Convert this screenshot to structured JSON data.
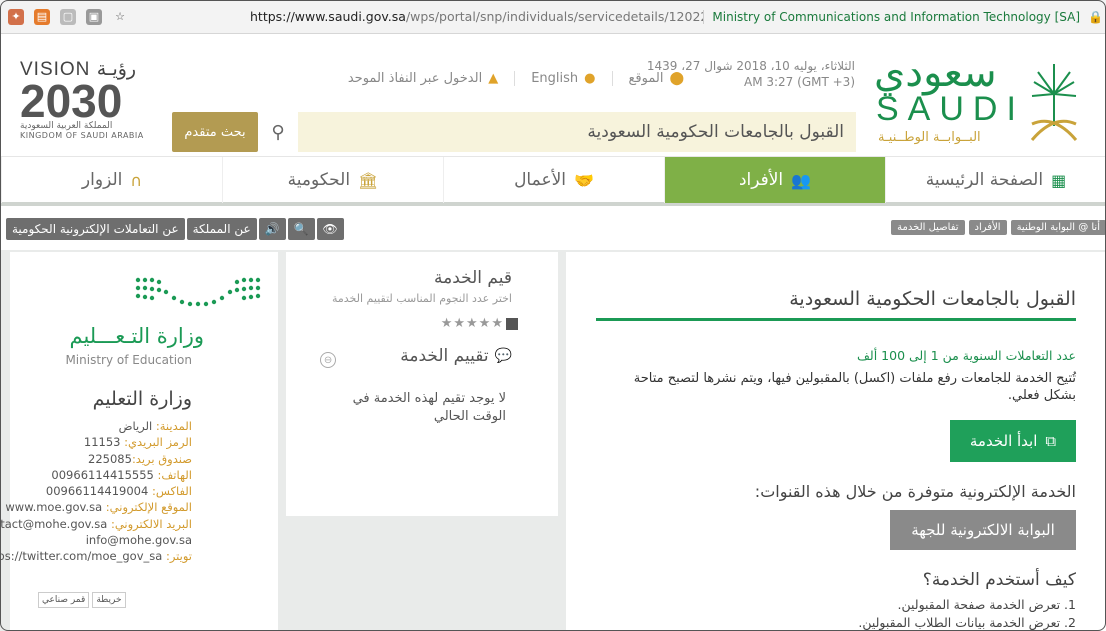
{
  "browser": {
    "url_host": "https://www.saudi.gov.sa",
    "url_path": "/wps/portal/snp/individuals/servicedetails/12022",
    "site_name": "Ministry of Communications and Information Technology [SA]"
  },
  "header": {
    "saudi_ar": "سعودي",
    "saudi_en": "SAUDI",
    "saudi_sub": "البــوابــة الوطــنيـة",
    "vision_top": "VISION رؤيـة",
    "vision_num": "2030",
    "vision_ar": "المملكة العربية السعودية",
    "vision_en": "KINGDOM OF SAUDI ARABIA",
    "link_location": "الموقع",
    "link_english": "English",
    "link_login": "الدخول عبر النفاذ الموحد",
    "date_line1": "الثلاثاء، يوليه 10، 2018 شوال 27، 1439",
    "date_line2": "(GMT +3) AM 3:27",
    "search_value": "القبول بالجامعات الحكومية السعودية",
    "advanced_search": "بحث متقدم"
  },
  "nav": {
    "home": "الصفحة الرئيسية",
    "individuals": "الأفراد",
    "business": "الأعمال",
    "government": "الحكومية",
    "visitors": "الزوار"
  },
  "toolbar": {
    "egov": "عن التعاملات الإلكترونية الحكومية",
    "kingdom": "عن المملكة",
    "crumbs": [
      "أنا @ البوابة الوطنية",
      "الأفراد",
      "تفاصيل الخدمة"
    ]
  },
  "ministry": {
    "moe_ar": "وزارة التـعـــليم",
    "moe_en": "Ministry of Education",
    "title": "وزارة التعليم",
    "info": [
      {
        "k": "المدينة:",
        "v": "الرياض"
      },
      {
        "k": "الرمز البريدي:",
        "v": "11153"
      },
      {
        "k": "صندوق بريد:",
        "v": "225085"
      },
      {
        "k": "الهاتف:",
        "v": "00966114415555"
      },
      {
        "k": "الفاكس:",
        "v": "00966114419004"
      },
      {
        "k": "الموقع الإلكتروني:",
        "v": "www.moe.gov.sa"
      },
      {
        "k": "البريد الالكتروني:",
        "v": "contact@mohe.gov.sa -"
      },
      {
        "k": "",
        "v": "info@mohe.gov.sa"
      },
      {
        "k": "تويتر:",
        "v": "https://twitter.com/moe_gov_sa"
      }
    ],
    "map_tabs": [
      "قمر صناعي",
      "خريطة"
    ]
  },
  "rating": {
    "title": "قيم الخدمة",
    "subtitle": "اختر عدد النجوم المناسب لتقييم الخدمة",
    "stars": "★★★★★",
    "heading": "تقييم الخدمة",
    "empty": "لا يوجد تقيم لهذه الخدمة في الوقت الحالي"
  },
  "main": {
    "title": "القبول بالجامعات الحكومية السعودية",
    "annual": "عدد التعاملات السنوية من 1 إلى 100 ألف",
    "desc": "تُتيح الخدمة للجامعات رفع ملفات (اكسل) بالمقبولين فيها، ويتم نشرها لتصبح متاحة بشكل فعلي.",
    "start": "ابدأ الخدمة",
    "channels": "الخدمة الإلكترونية متوفرة من خلال هذه القنوات:",
    "portal": "البوابة الالكترونية للجهة",
    "how": "كيف أستخدم الخدمة؟",
    "steps": [
      "1. تعرض الخدمة صفحة المقبولين.",
      "2. تعرض الخدمة بيانات الطلاب المقبولين."
    ]
  },
  "colors": {
    "green": "#1b8f4d",
    "active_nav": "#7fb047",
    "gold": "#c9a33a"
  }
}
